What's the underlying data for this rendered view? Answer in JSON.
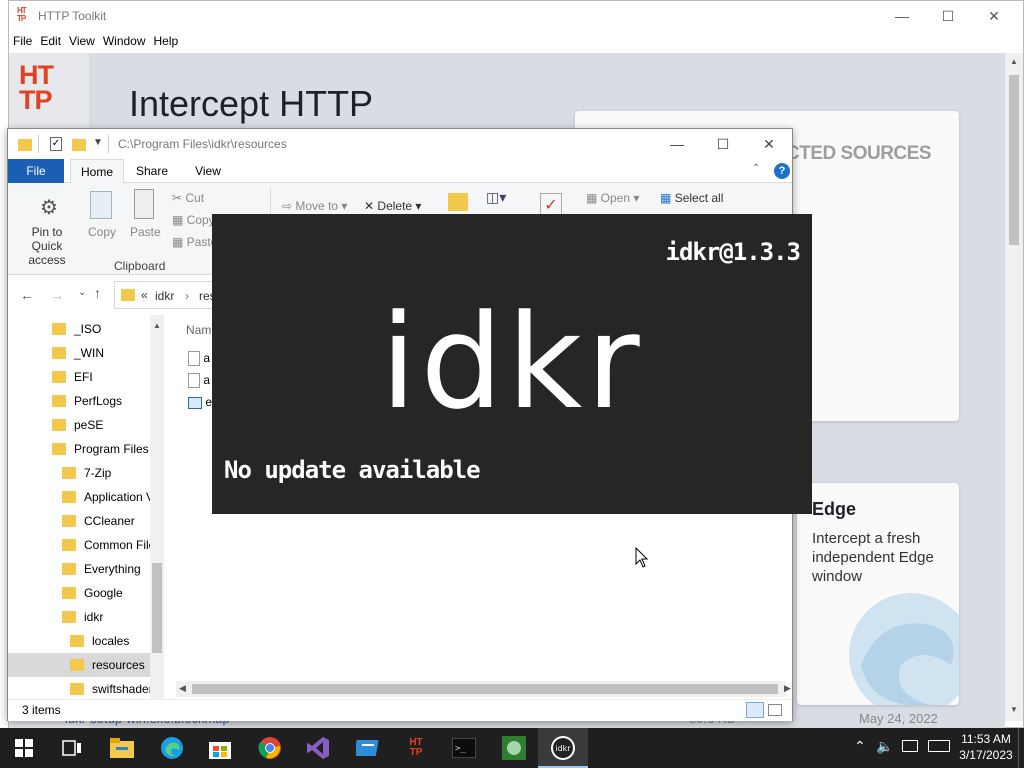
{
  "httptoolkit": {
    "window_title": "HTTP Toolkit",
    "logo_small": "HT TP",
    "menu": [
      "File",
      "Edit",
      "View",
      "Window",
      "Help"
    ],
    "logo_big_line1": "HT",
    "logo_big_line2": "TP",
    "heading": "Intercept HTTP",
    "sources_heading": "CTED SOURCES",
    "edge_card": {
      "title": "Edge",
      "desc": "Intercept a fresh independent Edge window"
    },
    "bottom_row": {
      "file": "idkr-setup-win.exe.blockmap",
      "size": "89.6 KB",
      "date": "May 24, 2022"
    }
  },
  "explorer": {
    "path": "C:\\Program Files\\idkr\\resources",
    "tabs": {
      "file": "File",
      "home": "Home",
      "share": "Share",
      "view": "View"
    },
    "ribbon": {
      "pin": "Pin to Quick",
      "pin2": "access",
      "copy": "Copy",
      "paste": "Paste",
      "cut": "Cut",
      "copy_path": "Copy",
      "paste_shortcut": "Paste",
      "move_to": "Move to",
      "delete": "Delete",
      "open": "Open",
      "select_all": "Select all",
      "clipboard": "Clipboard"
    },
    "address": {
      "prefix": "«",
      "seg1": "idkr",
      "seg2": "res"
    },
    "nav_items": [
      {
        "label": "_ISO",
        "indent": 0
      },
      {
        "label": "_WIN",
        "indent": 0
      },
      {
        "label": "EFI",
        "indent": 0
      },
      {
        "label": "PerfLogs",
        "indent": 0
      },
      {
        "label": "peSE",
        "indent": 0
      },
      {
        "label": "Program Files",
        "indent": 0
      },
      {
        "label": "7-Zip",
        "indent": 1
      },
      {
        "label": "Application V",
        "indent": 1
      },
      {
        "label": "CCleaner",
        "indent": 1
      },
      {
        "label": "Common File",
        "indent": 1
      },
      {
        "label": "Everything",
        "indent": 1
      },
      {
        "label": "Google",
        "indent": 1
      },
      {
        "label": "idkr",
        "indent": 1
      },
      {
        "label": "locales",
        "indent": 2
      },
      {
        "label": "resources",
        "indent": 2,
        "selected": true
      },
      {
        "label": "swiftshader",
        "indent": 2
      }
    ],
    "column_name": "Nam",
    "files": [
      "a",
      "a",
      "e"
    ],
    "status": "3 items"
  },
  "splash": {
    "version": "idkr@1.3.3",
    "brand": "idkr",
    "message": "No update available"
  },
  "taskbar": {
    "time": "11:53 AM",
    "date": "3/17/2023",
    "pinned": [
      "start-icon",
      "task-view-icon",
      "file-explorer-icon",
      "edge-icon",
      "store-icon",
      "chrome-icon",
      "visual-studio-icon",
      "folder-app-icon",
      "httptoolkit-icon",
      "terminal-icon",
      "app-icon",
      "idkr-icon"
    ]
  },
  "colors": {
    "httptoolkit_orange": "#e1421f",
    "explorer_file_tab": "#1a5fb4",
    "splash_bg": "#262626",
    "taskbar_bg": "#1f1f1f"
  }
}
